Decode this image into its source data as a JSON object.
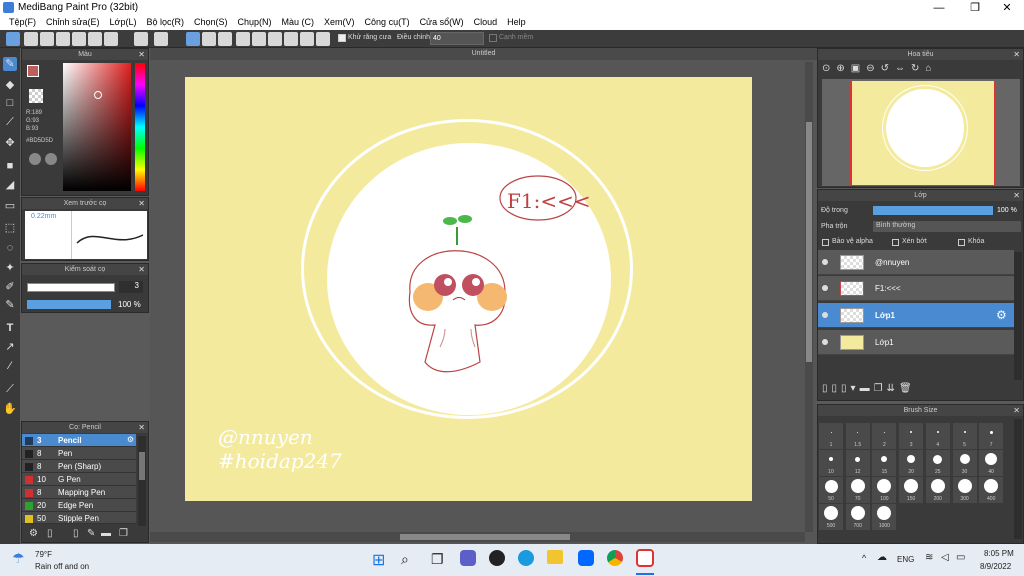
{
  "window": {
    "title": "MediBang Paint Pro (32bit)",
    "minimize": "—",
    "maximize": "❐",
    "close": "✕"
  },
  "menu": [
    "Tệp(F)",
    "Chỉnh sửa(E)",
    "Lớp(L)",
    "Bộ lọc(R)",
    "Chọn(S)",
    "Chụp(N)",
    "Màu (C)",
    "Xem(V)",
    "Công cụ(T)",
    "Cửa sổ(W)",
    "Cloud",
    "Help"
  ],
  "toolbar": {
    "antialias_label": "Khử răng cưa",
    "adjust_label": "Điều chỉnh",
    "adjust_value": "40",
    "smooth_label": "Cạnh mềm"
  },
  "color_panel": {
    "title": "Màu",
    "r": "R:189",
    "g": "G:93",
    "b": "B:93",
    "hex": "#BD5D5D",
    "fg_color": "#bd5d5d"
  },
  "brush_preview": {
    "title": "Xem trước cọ",
    "size": "0.22mm"
  },
  "brush_control": {
    "title": "Kiểm soát cọ",
    "size_value": "3",
    "opacity_value": "100 %"
  },
  "canvas": {
    "tab_title": "Untitled",
    "speech": "F1:<<<",
    "watermark1": "@nnuyen",
    "watermark2": "#hoidap247"
  },
  "navigator": {
    "title": "Hoa tiêu"
  },
  "layers": {
    "title": "Lớp",
    "opacity_label": "Độ trong",
    "opacity_value": "100 %",
    "blend_label": "Pha trộn",
    "blend_value": "Bình thường",
    "protect_alpha": "Bảo vệ alpha",
    "clipping": "Xén bớt",
    "lock": "Khóa",
    "items": [
      {
        "name": "@nnuyen"
      },
      {
        "name": "F1:<<<"
      },
      {
        "name": "Lớp1"
      },
      {
        "name": "Lớp1"
      }
    ]
  },
  "brush_size": {
    "title": "Brush Size",
    "sizes": [
      "1",
      "1.5",
      "2",
      "3",
      "4",
      "5",
      "7",
      "10",
      "12",
      "15",
      "20",
      "25",
      "30",
      "40",
      "50",
      "70",
      "100",
      "150",
      "200",
      "300",
      "400",
      "500",
      "700",
      "1000"
    ]
  },
  "brush_list": {
    "title": "Cọ: Pencil",
    "items": [
      {
        "size": "3",
        "name": "Pencil",
        "color": "#1f3a5a"
      },
      {
        "size": "8",
        "name": "Pen",
        "color": "#222222"
      },
      {
        "size": "8",
        "name": "Pen (Sharp)",
        "color": "#222222"
      },
      {
        "size": "10",
        "name": "G Pen",
        "color": "#d03030"
      },
      {
        "size": "8",
        "name": "Mapping Pen",
        "color": "#d03030"
      },
      {
        "size": "20",
        "name": "Edge Pen",
        "color": "#30a030"
      },
      {
        "size": "50",
        "name": "Stipple Pen",
        "color": "#e0c020"
      }
    ]
  },
  "taskbar": {
    "weather_temp": "79°F",
    "weather_desc": "Rain off and on",
    "lang": "ENG",
    "time": "8:05 PM",
    "date": "8/9/2022"
  }
}
